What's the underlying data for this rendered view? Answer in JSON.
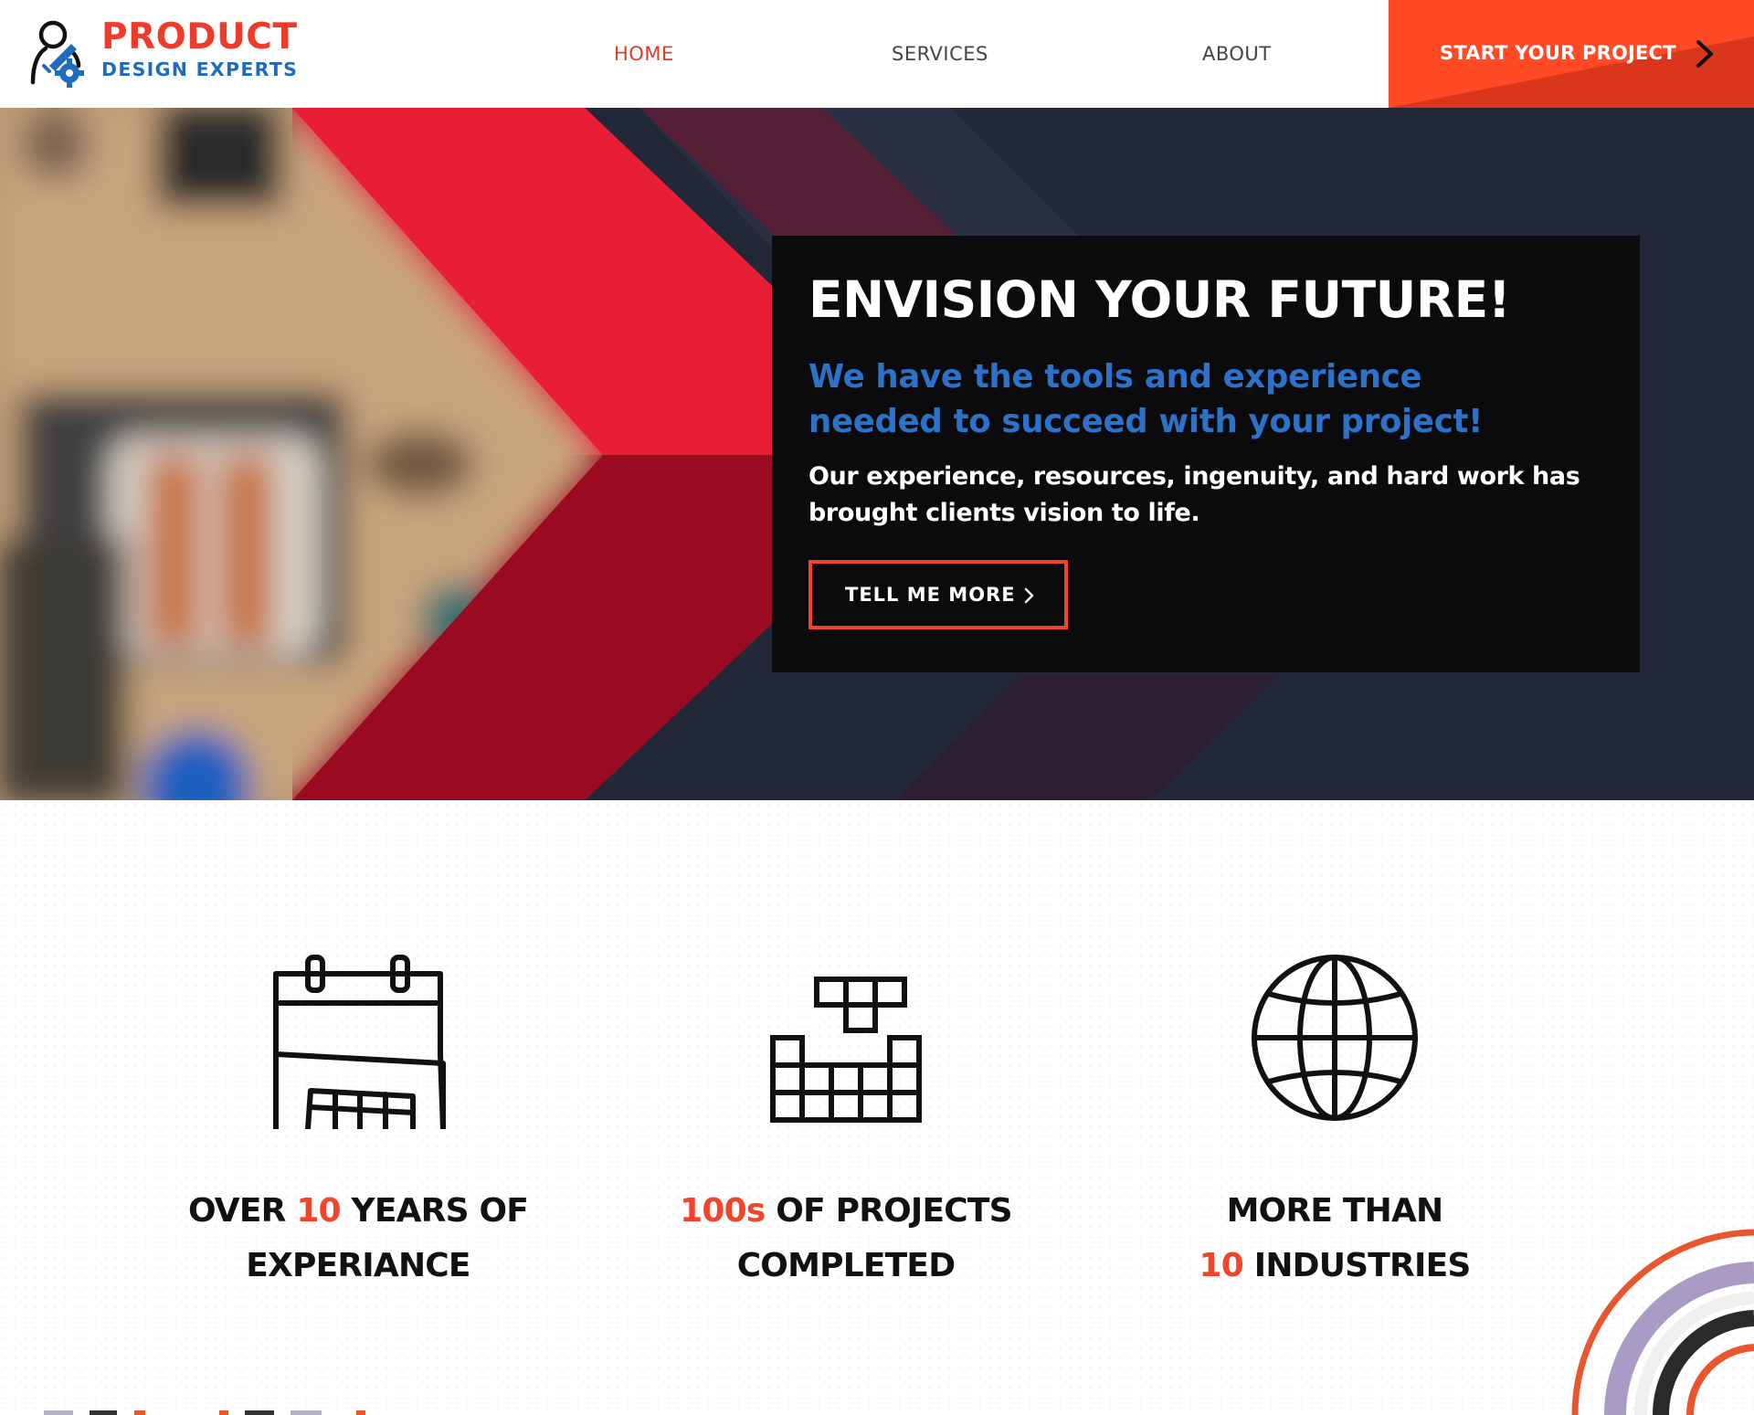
{
  "logo": {
    "line1": "PRODUCT",
    "line2": "DESIGN EXPERTS",
    "icon": "person-gear-logo-icon"
  },
  "nav": {
    "home": "HOME",
    "services": "SERVICES",
    "about": "ABOUT",
    "active": "HOME"
  },
  "cta": {
    "label": "START YOUR PROJECT",
    "icon": "chevron-right-icon"
  },
  "hero": {
    "title": "ENVISION YOUR FUTURE!",
    "subtitle_line1": "We have the tools and experience",
    "subtitle_line2": "needed to succeed with your project!",
    "body_line1": "Our experience, resources, ingenuity, and hard work has",
    "body_line2": "brought clients vision to life.",
    "button_label": "TELL ME MORE",
    "button_icon": "chevron-right-icon"
  },
  "stats": [
    {
      "icon": "calendar-icon",
      "line1_pre": "OVER ",
      "line1_accent": "10",
      "line1_post": " YEARS OF",
      "line2_accent": "",
      "line2_post": "EXPERIANCE"
    },
    {
      "icon": "blocks-icon",
      "line1_pre": "",
      "line1_accent": "100s",
      "line1_post": " OF PROJECTS",
      "line2_accent": "",
      "line2_post": "COMPLETED"
    },
    {
      "icon": "globe-icon",
      "line1_pre": "MORE THAN",
      "line1_accent": "",
      "line1_post": "",
      "line2_accent": "10",
      "line2_post": " INDUSTRIES"
    }
  ],
  "colors": {
    "brand_red": "#ee3b2b",
    "brand_blue": "#1f6bbd",
    "cta_orange": "#ff4a25",
    "hero_navy": "#232839",
    "hero_red": "#e81d36",
    "panel_black": "#0b0b0e"
  }
}
